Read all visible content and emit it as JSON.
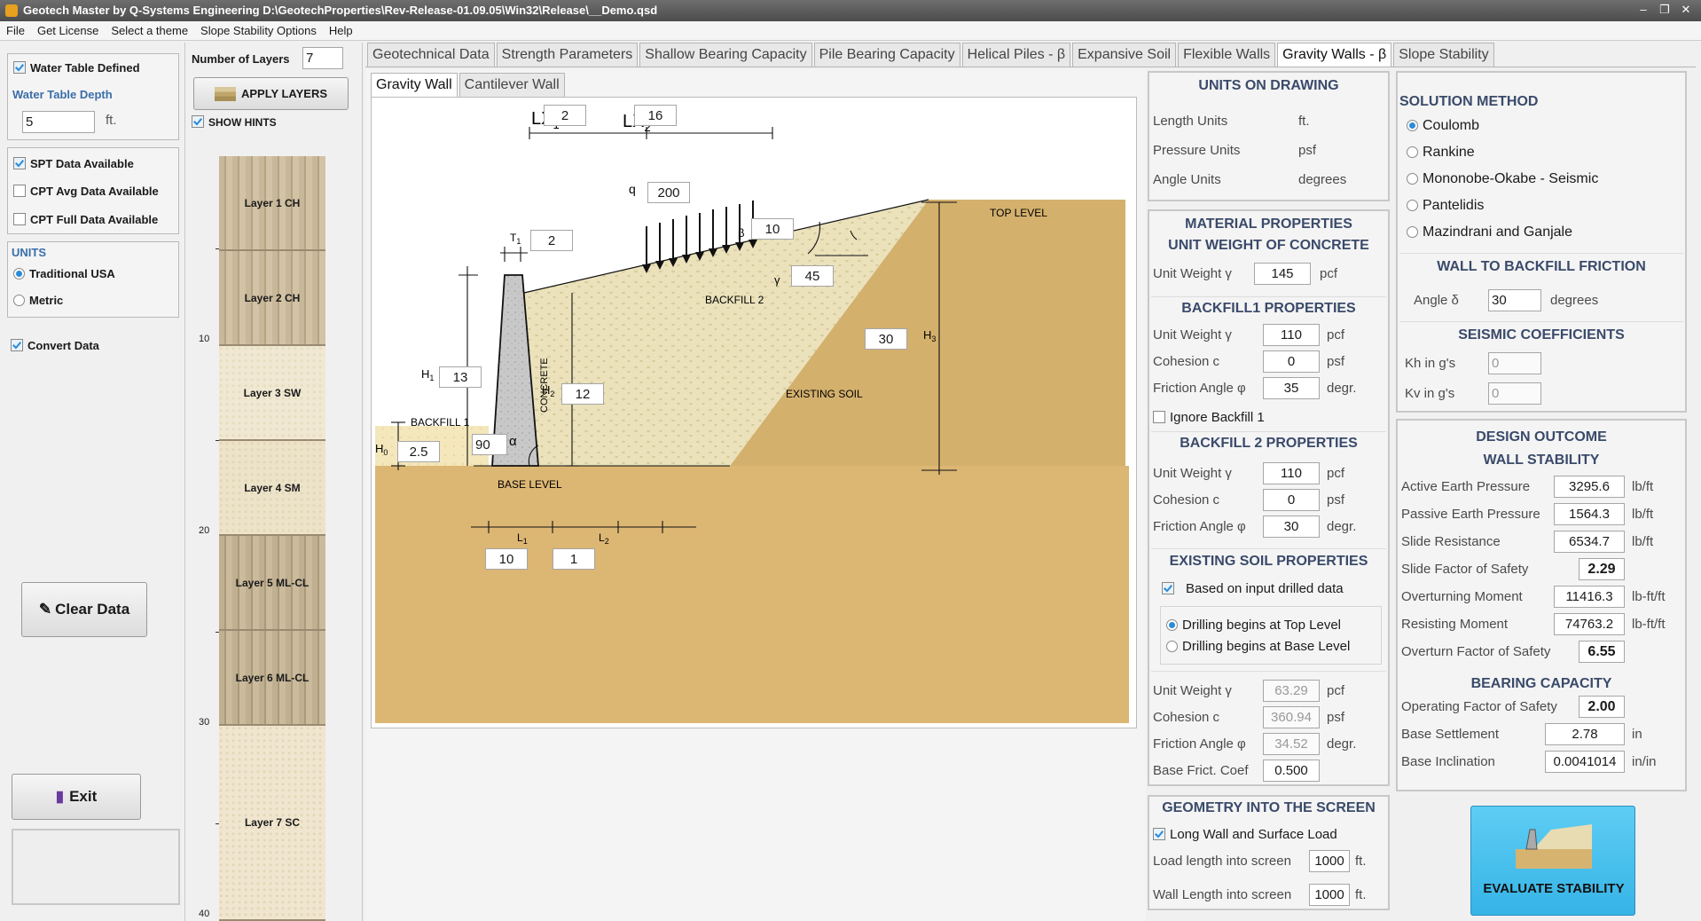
{
  "window": {
    "title": "Geotech Master by Q-Systems Engineering   D:\\GeotechProperties\\Rev-Release-01.09.05\\Win32\\Release\\__Demo.qsd",
    "min": "–",
    "restore": "❐",
    "close": "✕"
  },
  "menu": [
    "File",
    "Get License",
    "Select a theme",
    "Slope Stability Options",
    "Help"
  ],
  "left": {
    "water_table_defined": "Water Table Defined",
    "water_table_depth_label": "Water Table Depth",
    "water_table_depth_value": "5",
    "water_table_depth_unit": "ft.",
    "spt": "SPT Data Available",
    "cpt_avg": "CPT Avg Data Available",
    "cpt_full": "CPT Full Data Available",
    "units_title": "UNITS",
    "unit_usa": "Traditional USA",
    "unit_metric": "Metric",
    "convert": "Convert Data",
    "clear_btn": "Clear Data",
    "exit_btn": "Exit"
  },
  "layers_panel": {
    "num_label": "Number of Layers",
    "num_value": "7",
    "apply": "APPLY LAYERS",
    "hints": "SHOW HINTS",
    "ticks": [
      "10",
      "20",
      "30",
      "40"
    ],
    "layers": [
      "Layer 1 CH",
      "Layer 2 CH",
      "Layer 3 SW",
      "Layer 4 SM",
      "Layer 5 ML-CL",
      "Layer 6 ML-CL",
      "Layer 7 SC"
    ]
  },
  "main_tabs": [
    "Geotechnical Data",
    "Strength Parameters",
    "Shallow Bearing Capacity",
    "Pile Bearing Capacity",
    "Helical Piles - β",
    "Expansive Soil",
    "Flexible Walls",
    "Gravity Walls - β",
    "Slope Stability"
  ],
  "sub_tabs": [
    "Gravity Wall",
    "Cantilever Wall"
  ],
  "drawing": {
    "lx1_label": "LX",
    "lx1_sub": "1",
    "lx1": "2",
    "lx2_label": "LX",
    "lx2_sub": "2",
    "lx2": "16",
    "q_label": "q",
    "q": "200",
    "t1_label": "T",
    "t1_sub": "1",
    "t1": "2",
    "beta_label": "β",
    "beta": "10",
    "gamma_label": "γ",
    "gamma": "45",
    "h1_label": "H",
    "h1_sub": "1",
    "h1": "13",
    "h2_label": "H",
    "h2_sub": "2",
    "h2": "12",
    "h3_label": "H",
    "h3_sub": "3",
    "h3": "30",
    "h0_label": "H",
    "h0_sub": "0",
    "h0": "2.5",
    "alpha_label": "α",
    "alpha": "90",
    "l1_label": "L",
    "l1_sub": "1",
    "l1": "10",
    "l2_label": "L",
    "l2_sub": "2",
    "l2": "1",
    "top_level": "TOP LEVEL",
    "base_level": "BASE LEVEL",
    "backfill1": "BACKFILL 1",
    "backfill2": "BACKFILL 2",
    "existing": "EXISTING SOIL",
    "concrete": "CONCRETE"
  },
  "units": {
    "title": "UNITS ON DRAWING",
    "rows": [
      [
        "Length Units",
        "ft."
      ],
      [
        "Pressure Units",
        "psf"
      ],
      [
        "Angle Units",
        "degrees"
      ]
    ]
  },
  "material": {
    "title": "MATERIAL PROPERTIES",
    "concrete_title": "UNIT WEIGHT OF CONCRETE",
    "conc_label": "Unit Weight γ",
    "conc_value": "145",
    "conc_unit": "pcf",
    "bf1_title": "BACKFILL1 PROPERTIES",
    "bf1": [
      [
        "Unit Weight γ",
        "110",
        "pcf"
      ],
      [
        "Cohesion  c",
        "0",
        "psf"
      ],
      [
        "Friction Angle φ",
        "35",
        "degr."
      ]
    ],
    "ignore_bf1": "Ignore Backfill 1",
    "bf2_title": "BACKFILL 2 PROPERTIES",
    "bf2": [
      [
        "Unit Weight γ",
        "110",
        "pcf"
      ],
      [
        "Cohesion  c",
        "0",
        "psf"
      ],
      [
        "Friction Angle φ",
        "30",
        "degr."
      ]
    ],
    "ex_title": "EXISTING SOIL PROPERTIES",
    "ex_drilled": "Based on input drilled data",
    "ex_top": "Drilling begins at Top Level",
    "ex_base": "Drilling begins at Base Level",
    "ex": [
      [
        "Unit Weight γ",
        "63.29",
        "pcf"
      ],
      [
        "Cohesion  c",
        "360.94",
        "psf"
      ],
      [
        "Friction Angle φ",
        "34.52",
        "degr."
      ]
    ],
    "base_frict_label": "Base Frict. Coef",
    "base_frict": "0.500"
  },
  "geometry": {
    "title": "GEOMETRY INTO THE SCREEN",
    "long_wall": "Long Wall and Surface Load",
    "load_len_label": "Load length into screen",
    "load_len": "1000",
    "load_unit": "ft.",
    "wall_len_label": "Wall Length into screen",
    "wall_len": "1000",
    "wall_unit": "ft."
  },
  "solution": {
    "title": "SOLUTION METHOD",
    "methods": [
      "Coulomb",
      "Rankine",
      "Mononobe-Okabe - Seismic",
      "Pantelidis",
      "Mazindrani and Ganjale"
    ],
    "friction_title": "WALL TO BACKFILL FRICTION",
    "angle_label": "Angle δ",
    "angle": "30",
    "angle_unit": "degrees",
    "seismic_title": "SEISMIC COEFFICIENTS",
    "kh_label": "Kh in g's",
    "kh": "0",
    "kv_label": "Kv in g's",
    "kv": "0"
  },
  "outcome": {
    "title": "DESIGN OUTCOME",
    "stab_title": "WALL STABILITY",
    "rows": [
      [
        "Active Earth Pressure",
        "3295.6",
        "lb/ft",
        false
      ],
      [
        "Passive Earth Pressure",
        "1564.3",
        "lb/ft",
        false
      ],
      [
        "Slide Resistance",
        "6534.7",
        "lb/ft",
        false
      ],
      [
        "Slide Factor of Safety",
        "2.29",
        "",
        true
      ],
      [
        "Overturning Moment",
        "11416.3",
        "lb-ft/ft",
        false
      ],
      [
        "Resisting Moment",
        "74763.2",
        "lb-ft/ft",
        false
      ],
      [
        "Overturn Factor of Safety",
        "6.55",
        "",
        true
      ]
    ],
    "bear_title": "BEARING CAPACITY",
    "bear": [
      [
        "Operating Factor of Safety",
        "2.00",
        "",
        true
      ],
      [
        "Base Settlement",
        "2.78",
        "in",
        false
      ],
      [
        "Base Inclination",
        "0.0041014",
        "in/in",
        false
      ]
    ],
    "evaluate": "EVALUATE STABILITY"
  }
}
